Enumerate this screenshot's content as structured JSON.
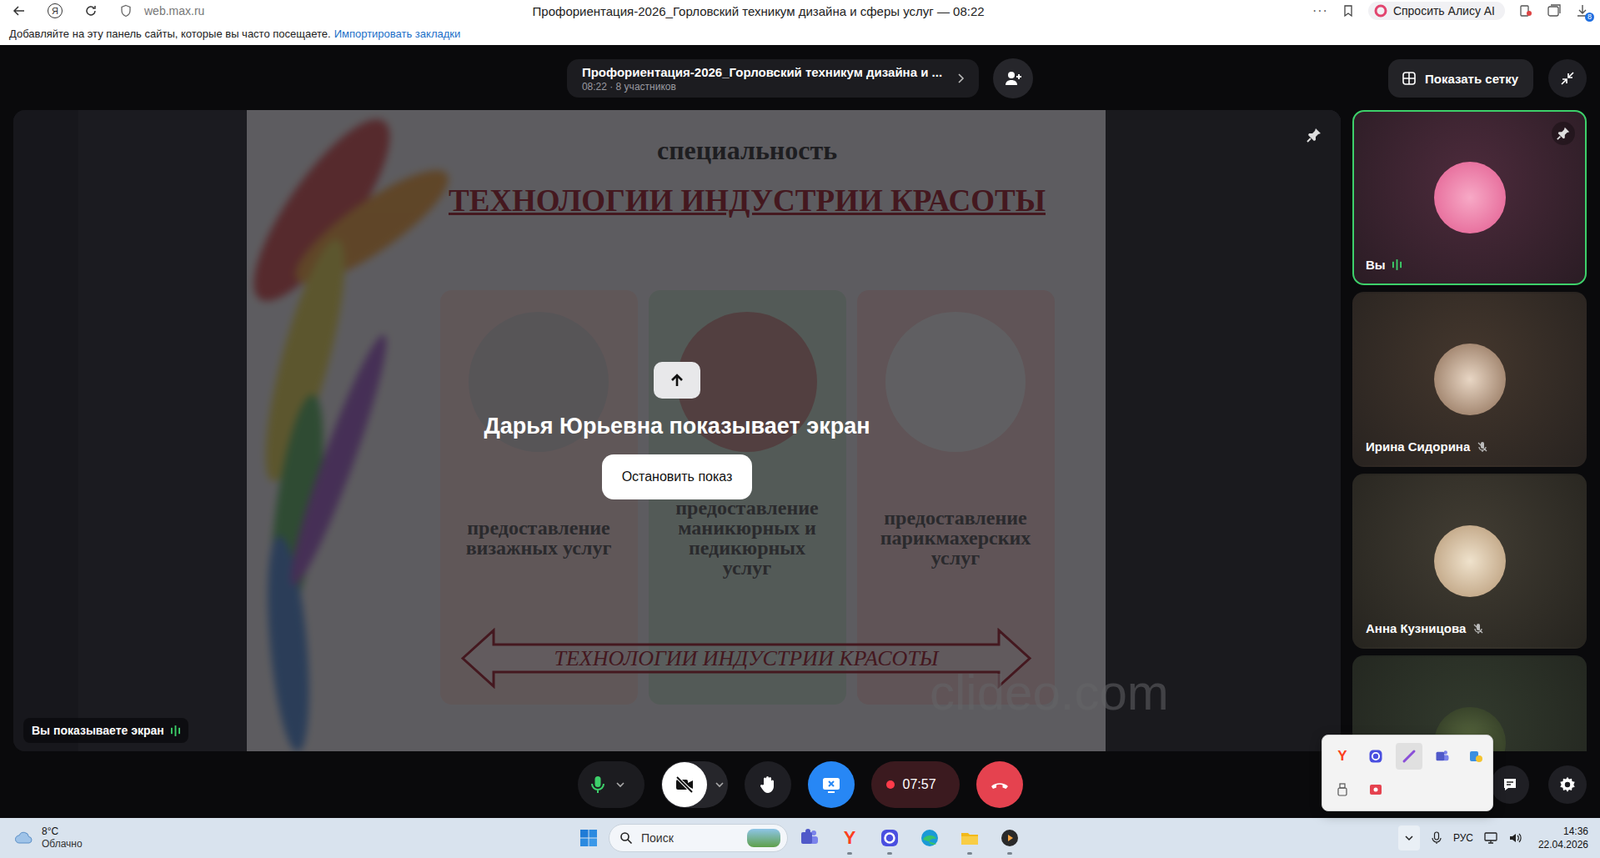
{
  "browser": {
    "logo": "Я",
    "url": "web.max.ru",
    "title": "Профориентация-2026_Горловский техникум дизайна и сферы услуг — 08:22",
    "more": "···",
    "alice": "Спросить Алису AI",
    "downloads_badge": "8"
  },
  "bookmarks_bar": {
    "hint": "Добавляйте на эту панель сайты, которые вы часто посещаете.",
    "link": "Импортировать закладки"
  },
  "call": {
    "title": "Профориентация-2026_Горловский техникум дизайна и ...",
    "time": "08:22",
    "separator": "·",
    "participants_count": "8 участников"
  },
  "grid_button": "Показать сетку",
  "stage": {
    "message": "Дарья Юрьевна показывает экран",
    "stop_button": "Остановить показ",
    "self_badge": "Вы показываете экран",
    "self_speaking": true
  },
  "slide": {
    "subtitle": "специальность",
    "title": "ТЕХНОЛОГИИ ИНДУСТРИИ КРАСОТЫ",
    "cards": [
      {
        "text": "предоставление\nвизажных услуг"
      },
      {
        "text": "предоставление\nманикюрных и\nпедикюрных\nуслуг"
      },
      {
        "text": "предоставление\nпарикмахерских\nуслуг"
      }
    ],
    "arrow_text": "ТЕХНОЛОГИИ ИНДУСТРИИ КРАСОТЫ",
    "watermark": "clideo.com"
  },
  "participants": [
    {
      "name": "Вы",
      "muted": false,
      "speaking": true,
      "selected": true
    },
    {
      "name": "Ирина Сидорина",
      "muted": true,
      "speaking": false,
      "selected": false
    },
    {
      "name": "Анна Кузницова",
      "muted": true,
      "speaking": false,
      "selected": false
    },
    {
      "name": "",
      "muted": false,
      "speaking": false,
      "selected": false
    }
  ],
  "controls": {
    "mic_on": true,
    "camera_on": false,
    "hand_raised": false,
    "screen_sharing": true,
    "recording": true,
    "record_time": "07:57"
  },
  "tray_popup": {
    "icons": [
      {
        "kind": "yandex",
        "logo": "Y",
        "selected": false
      },
      {
        "kind": "max",
        "logo": "",
        "selected": false
      },
      {
        "kind": "pen",
        "logo": "",
        "selected": true
      },
      {
        "kind": "teams",
        "logo": "",
        "selected": false
      },
      {
        "kind": "vpn",
        "logo": "",
        "selected": false
      },
      {
        "kind": "usb",
        "logo": "",
        "selected": false
      },
      {
        "kind": "recorder",
        "logo": "",
        "selected": false
      }
    ]
  },
  "taskbar": {
    "weather_temp": "8°C",
    "weather_desc": "Облачно",
    "search_placeholder": "Поиск",
    "apps": [
      {
        "kind": "teams",
        "logo": "",
        "running": false
      },
      {
        "kind": "yandex",
        "logo": "Y",
        "running": true
      },
      {
        "kind": "max",
        "logo": "",
        "running": true
      },
      {
        "kind": "edge",
        "logo": "",
        "running": false
      },
      {
        "kind": "explorer",
        "logo": "",
        "running": true
      },
      {
        "kind": "media",
        "logo": "",
        "running": true
      }
    ],
    "language": "РУС",
    "time": "14:36",
    "date": "22.04.2026"
  }
}
